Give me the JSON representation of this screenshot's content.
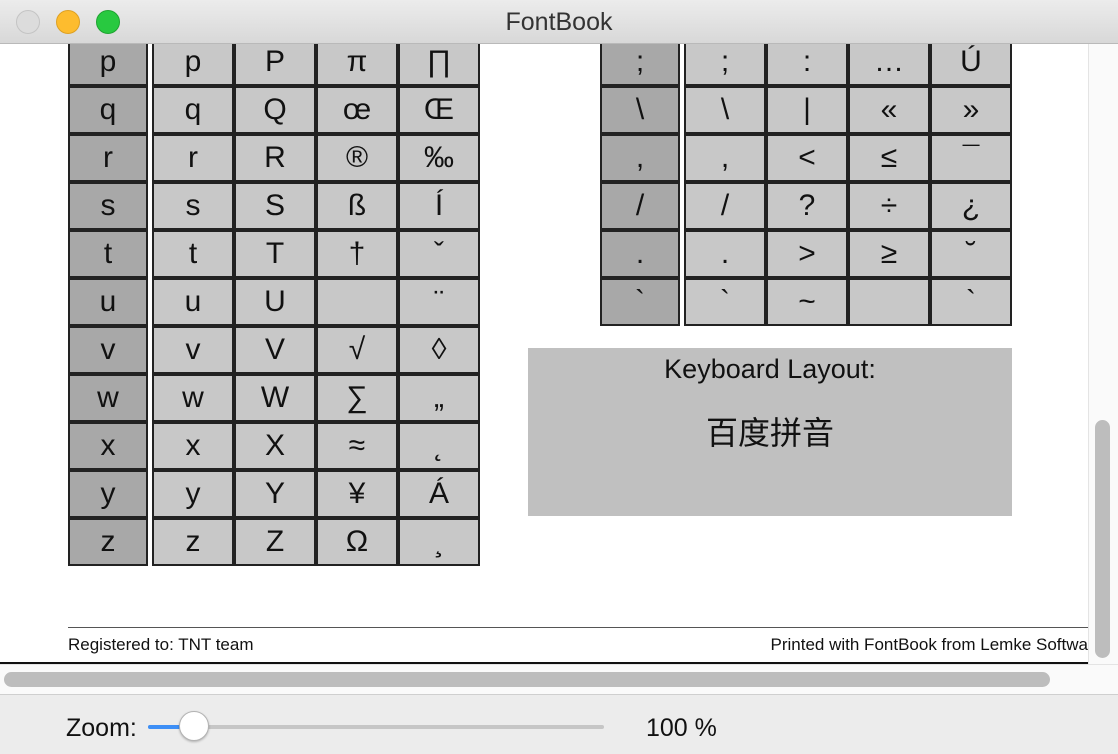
{
  "window": {
    "title": "FontBook"
  },
  "left_table": {
    "rows": [
      {
        "key": "p",
        "chars": [
          "p",
          "P",
          "π",
          "∏"
        ]
      },
      {
        "key": "q",
        "chars": [
          "q",
          "Q",
          "œ",
          "Œ"
        ]
      },
      {
        "key": "r",
        "chars": [
          "r",
          "R",
          "®",
          "‰"
        ]
      },
      {
        "key": "s",
        "chars": [
          "s",
          "S",
          "ß",
          "Í"
        ]
      },
      {
        "key": "t",
        "chars": [
          "t",
          "T",
          "†",
          "ˇ"
        ]
      },
      {
        "key": "u",
        "chars": [
          "u",
          "U",
          "",
          "¨"
        ]
      },
      {
        "key": "v",
        "chars": [
          "v",
          "V",
          "√",
          "◊"
        ]
      },
      {
        "key": "w",
        "chars": [
          "w",
          "W",
          "∑",
          "„"
        ]
      },
      {
        "key": "x",
        "chars": [
          "x",
          "X",
          "≈",
          "˛"
        ]
      },
      {
        "key": "y",
        "chars": [
          "y",
          "Y",
          "¥",
          "Á"
        ]
      },
      {
        "key": "z",
        "chars": [
          "z",
          "Z",
          "Ω",
          "¸"
        ]
      }
    ]
  },
  "right_table": {
    "rows": [
      {
        "key": ";",
        "chars": [
          ";",
          ":",
          "…",
          "Ú"
        ]
      },
      {
        "key": "\\",
        "chars": [
          "\\",
          "|",
          "«",
          "»"
        ]
      },
      {
        "key": ",",
        "chars": [
          ",",
          "<",
          "≤",
          "¯"
        ]
      },
      {
        "key": "/",
        "chars": [
          "/",
          "?",
          "÷",
          "¿"
        ]
      },
      {
        "key": ".",
        "chars": [
          ".",
          ">",
          "≥",
          "˘"
        ]
      },
      {
        "key": "`",
        "chars": [
          "`",
          "~",
          "",
          "`"
        ]
      }
    ]
  },
  "keyboard": {
    "title": "Keyboard Layout:",
    "value": "百度拼音"
  },
  "footer": {
    "registered": "Registered to: TNT team",
    "printed": "Printed with FontBook from Lemke Softwa"
  },
  "zoom": {
    "label": "Zoom:",
    "value_text": "100 %",
    "slider_level": 0.1
  },
  "colors": {
    "key_column": "#a8a8a8",
    "char_cell": "#c8c8c8",
    "keyboard_box": "#c0c0c0",
    "slider_accent": "#3d8ff6"
  }
}
